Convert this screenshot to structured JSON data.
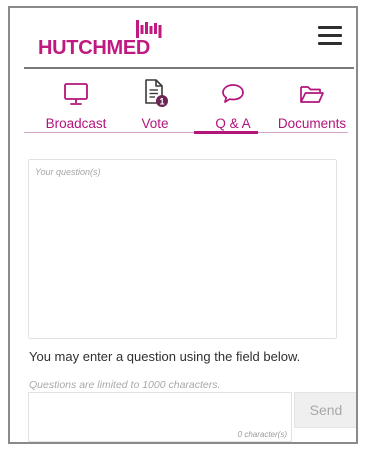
{
  "brand": {
    "name": "HUTCHMED",
    "color": "#c0197f"
  },
  "header": {
    "menu_icon": "hamburger-menu-icon"
  },
  "tabs": [
    {
      "label": "Broadcast",
      "icon": "monitor-icon",
      "active": false
    },
    {
      "label": "Vote",
      "icon": "document-icon",
      "active": false,
      "badge": "1"
    },
    {
      "label": "Q & A",
      "icon": "speech-bubble-icon",
      "active": true
    },
    {
      "label": "Documents",
      "icon": "folder-open-icon",
      "active": false
    }
  ],
  "question": {
    "placeholder": "Your question(s)",
    "info_text": "You may enter a question using the field below.",
    "limit_hint": "Questions are limited to 1000  characters.",
    "char_count": "0 character(s)",
    "send_label": "Send"
  },
  "colors": {
    "accent": "#b3157a",
    "send_button_bg": "#efefef"
  }
}
